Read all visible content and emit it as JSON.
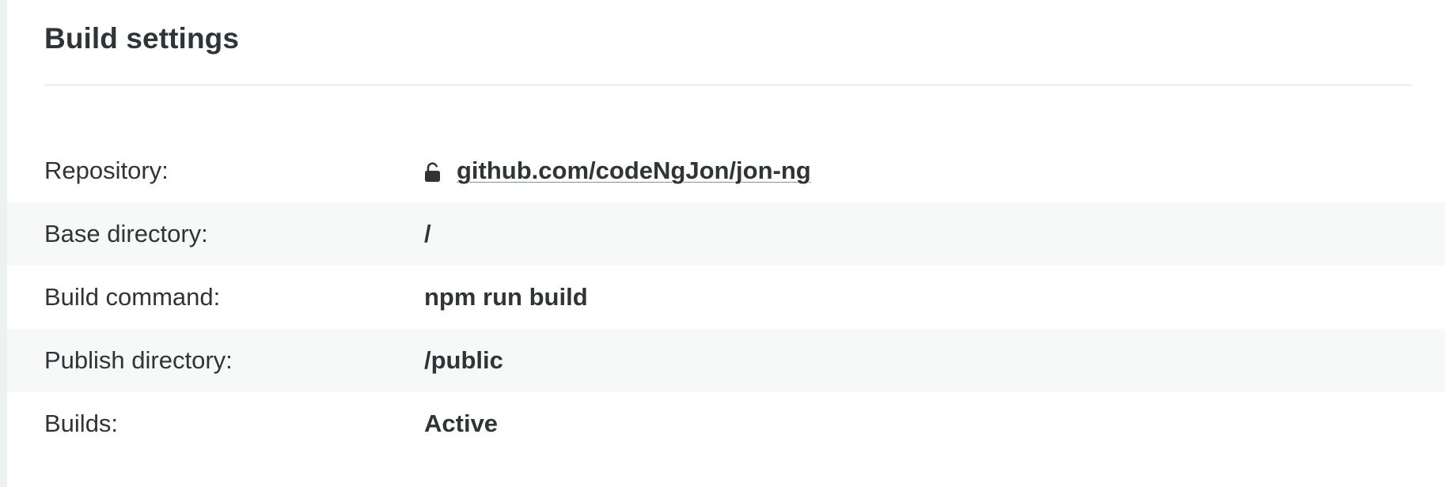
{
  "section": {
    "title": "Build settings"
  },
  "settings": {
    "repository": {
      "label": "Repository:",
      "value": "github.com/codeNgJon/jon-ng",
      "icon": "unlock-icon"
    },
    "base_directory": {
      "label": "Base directory:",
      "value": "/"
    },
    "build_command": {
      "label": "Build command:",
      "value": "npm run build"
    },
    "publish_directory": {
      "label": "Publish directory:",
      "value": "/public"
    },
    "builds": {
      "label": "Builds:",
      "value": "Active"
    }
  },
  "colors": {
    "text": "#2e3538",
    "row_alt_background": "#f7f8f8",
    "page_background": "#eef1f2",
    "card_background": "#ffffff"
  }
}
